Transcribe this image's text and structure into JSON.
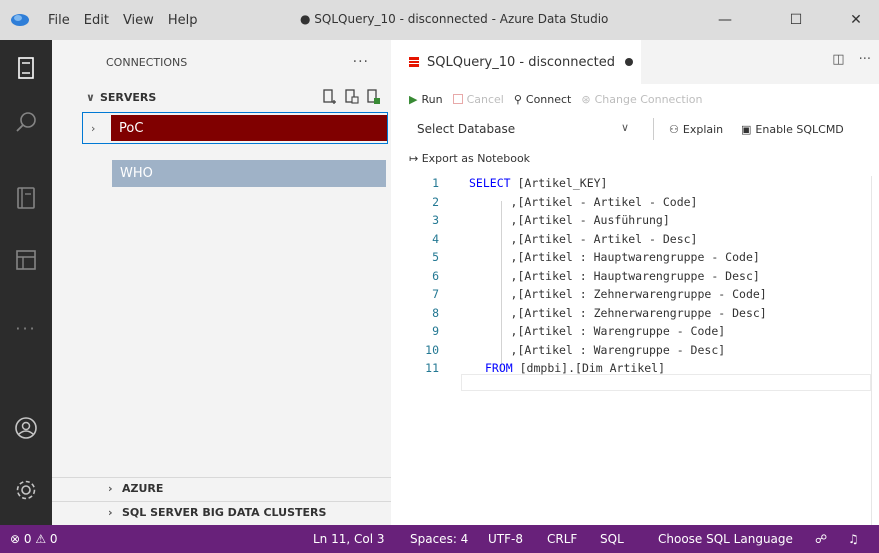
{
  "titlebar": {
    "menu": [
      "File",
      "Edit",
      "View",
      "Help"
    ],
    "title": "● SQLQuery_10 - disconnected - Azure Data Studio",
    "minimize": "—",
    "maximize": "☐",
    "close": "✕"
  },
  "sidebar": {
    "title": "CONNECTIONS",
    "more": "···",
    "servers_label": "SERVERS",
    "servers": [
      {
        "name": "PoC",
        "color": "#800000"
      },
      {
        "name": "WHO",
        "color": "#9fb2c7"
      }
    ],
    "sections": [
      "AZURE",
      "SQL SERVER BIG DATA CLUSTERS"
    ]
  },
  "editor": {
    "tab_label": "SQLQuery_10 - disconnected",
    "toolbar": {
      "run": "Run",
      "cancel": "Cancel",
      "connect": "Connect",
      "change_connection": "Change Connection",
      "select_database": "Select Database",
      "explain": "Explain",
      "enable_sqlcmd": "Enable SQLCMD",
      "export_notebook": "Export as Notebook"
    },
    "lines": [
      {
        "n": "1",
        "kw": "SELECT",
        "text": " [Artikel_KEY]"
      },
      {
        "n": "2",
        "kw": "",
        "text": "      ,[Artikel - Artikel - Code]"
      },
      {
        "n": "3",
        "kw": "",
        "text": "      ,[Artikel - Ausführung]"
      },
      {
        "n": "4",
        "kw": "",
        "text": "      ,[Artikel - Artikel - Desc]"
      },
      {
        "n": "5",
        "kw": "",
        "text": "      ,[Artikel : Hauptwarengruppe - Code]"
      },
      {
        "n": "6",
        "kw": "",
        "text": "      ,[Artikel : Hauptwarengruppe - Desc]"
      },
      {
        "n": "7",
        "kw": "",
        "text": "      ,[Artikel : Zehnerwarengruppe - Code]"
      },
      {
        "n": "8",
        "kw": "",
        "text": "      ,[Artikel : Zehnerwarengruppe - Desc]"
      },
      {
        "n": "9",
        "kw": "",
        "text": "      ,[Artikel : Warengruppe - Code]"
      },
      {
        "n": "10",
        "kw": "",
        "text": "      ,[Artikel : Warengruppe - Desc]"
      },
      {
        "n": "11",
        "kw": "FROM",
        "text": " [dmpbi].[Dim Artikel]"
      }
    ]
  },
  "statusbar": {
    "problems": "⊗ 0 ⚠ 0",
    "position": "Ln 11, Col 3",
    "spaces": "Spaces: 4",
    "encoding": "UTF-8",
    "eol": "CRLF",
    "language": "SQL",
    "choose_language": "Choose SQL Language"
  },
  "colors": {
    "statusbar": "#68217a",
    "activitybar": "#2c2c2c",
    "keyword": "#0000ff",
    "line_number": "#237893"
  }
}
